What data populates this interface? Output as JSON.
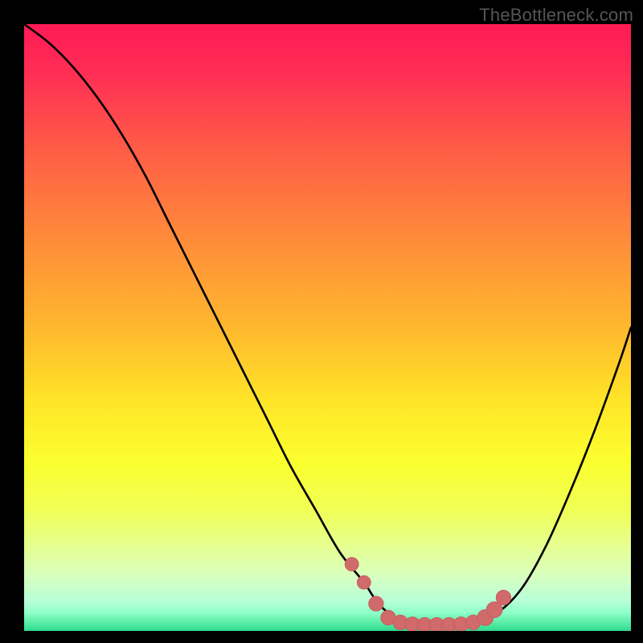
{
  "watermark": "TheBottleneck.com",
  "colors": {
    "black": "#000000",
    "curve": "#000000",
    "marker": "#d16a6a",
    "marker_stroke": "#c95f5f"
  },
  "chart_data": {
    "type": "line",
    "title": "",
    "xlabel": "",
    "ylabel": "",
    "xlim": [
      0,
      100
    ],
    "ylim": [
      0,
      100
    ],
    "gradient_stops": [
      {
        "offset": 0,
        "color": "#ff1a55"
      },
      {
        "offset": 8,
        "color": "#ff2e55"
      },
      {
        "offset": 20,
        "color": "#ff5a47"
      },
      {
        "offset": 35,
        "color": "#ff8a3a"
      },
      {
        "offset": 50,
        "color": "#ffb82e"
      },
      {
        "offset": 62,
        "color": "#ffe428"
      },
      {
        "offset": 72,
        "color": "#fbff2e"
      },
      {
        "offset": 80,
        "color": "#f0ff55"
      },
      {
        "offset": 86,
        "color": "#e6ff90"
      },
      {
        "offset": 91,
        "color": "#d8ffc0"
      },
      {
        "offset": 95,
        "color": "#b8ffd8"
      },
      {
        "offset": 97,
        "color": "#8effc8"
      },
      {
        "offset": 99,
        "color": "#4de8a0"
      },
      {
        "offset": 100,
        "color": "#2fd98e"
      }
    ],
    "series": [
      {
        "name": "bottleneck-curve",
        "x": [
          0,
          4,
          8,
          12,
          16,
          20,
          24,
          28,
          32,
          36,
          40,
          44,
          48,
          52,
          56,
          58,
          60,
          63,
          66,
          70,
          74,
          78,
          82,
          86,
          90,
          94,
          98,
          100
        ],
        "y": [
          100,
          97,
          93,
          88,
          82,
          75,
          67,
          59,
          51,
          43,
          35,
          27,
          20,
          13,
          8,
          5,
          3,
          1.5,
          1,
          1,
          1.3,
          3,
          7,
          14,
          23,
          33,
          44,
          50
        ]
      }
    ],
    "markers": {
      "name": "optimal-range",
      "points": [
        {
          "x": 54.0,
          "y": 11.0,
          "r": 1.1
        },
        {
          "x": 56.0,
          "y": 8.0,
          "r": 1.1
        },
        {
          "x": 58.0,
          "y": 4.5,
          "r": 1.2
        },
        {
          "x": 60.0,
          "y": 2.2,
          "r": 1.2
        },
        {
          "x": 62.0,
          "y": 1.4,
          "r": 1.2
        },
        {
          "x": 64.0,
          "y": 1.1,
          "r": 1.2
        },
        {
          "x": 66.0,
          "y": 1.0,
          "r": 1.2
        },
        {
          "x": 68.0,
          "y": 1.0,
          "r": 1.2
        },
        {
          "x": 70.0,
          "y": 1.0,
          "r": 1.2
        },
        {
          "x": 72.0,
          "y": 1.1,
          "r": 1.2
        },
        {
          "x": 74.0,
          "y": 1.4,
          "r": 1.2
        },
        {
          "x": 76.0,
          "y": 2.2,
          "r": 1.3
        },
        {
          "x": 77.5,
          "y": 3.5,
          "r": 1.3
        },
        {
          "x": 79.0,
          "y": 5.5,
          "r": 1.2
        }
      ]
    }
  }
}
